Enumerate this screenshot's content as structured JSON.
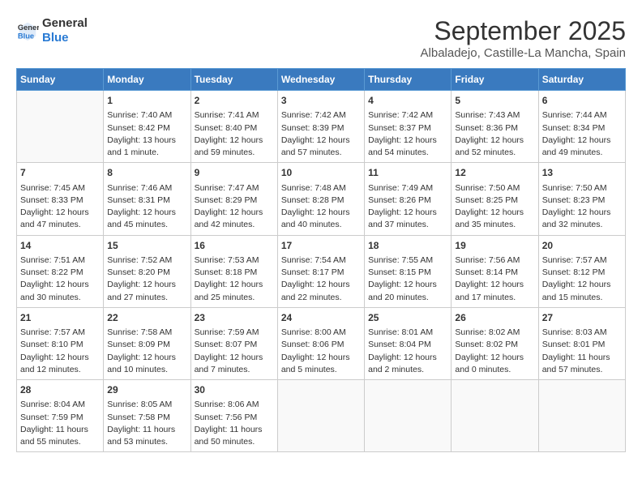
{
  "header": {
    "logo_general": "General",
    "logo_blue": "Blue",
    "title": "September 2025",
    "subtitle": "Albaladejo, Castille-La Mancha, Spain"
  },
  "days_header": [
    "Sunday",
    "Monday",
    "Tuesday",
    "Wednesday",
    "Thursday",
    "Friday",
    "Saturday"
  ],
  "weeks": [
    [
      {
        "day": "",
        "info": ""
      },
      {
        "day": "1",
        "info": "Sunrise: 7:40 AM\nSunset: 8:42 PM\nDaylight: 13 hours\nand 1 minute."
      },
      {
        "day": "2",
        "info": "Sunrise: 7:41 AM\nSunset: 8:40 PM\nDaylight: 12 hours\nand 59 minutes."
      },
      {
        "day": "3",
        "info": "Sunrise: 7:42 AM\nSunset: 8:39 PM\nDaylight: 12 hours\nand 57 minutes."
      },
      {
        "day": "4",
        "info": "Sunrise: 7:42 AM\nSunset: 8:37 PM\nDaylight: 12 hours\nand 54 minutes."
      },
      {
        "day": "5",
        "info": "Sunrise: 7:43 AM\nSunset: 8:36 PM\nDaylight: 12 hours\nand 52 minutes."
      },
      {
        "day": "6",
        "info": "Sunrise: 7:44 AM\nSunset: 8:34 PM\nDaylight: 12 hours\nand 49 minutes."
      }
    ],
    [
      {
        "day": "7",
        "info": "Sunrise: 7:45 AM\nSunset: 8:33 PM\nDaylight: 12 hours\nand 47 minutes."
      },
      {
        "day": "8",
        "info": "Sunrise: 7:46 AM\nSunset: 8:31 PM\nDaylight: 12 hours\nand 45 minutes."
      },
      {
        "day": "9",
        "info": "Sunrise: 7:47 AM\nSunset: 8:29 PM\nDaylight: 12 hours\nand 42 minutes."
      },
      {
        "day": "10",
        "info": "Sunrise: 7:48 AM\nSunset: 8:28 PM\nDaylight: 12 hours\nand 40 minutes."
      },
      {
        "day": "11",
        "info": "Sunrise: 7:49 AM\nSunset: 8:26 PM\nDaylight: 12 hours\nand 37 minutes."
      },
      {
        "day": "12",
        "info": "Sunrise: 7:50 AM\nSunset: 8:25 PM\nDaylight: 12 hours\nand 35 minutes."
      },
      {
        "day": "13",
        "info": "Sunrise: 7:50 AM\nSunset: 8:23 PM\nDaylight: 12 hours\nand 32 minutes."
      }
    ],
    [
      {
        "day": "14",
        "info": "Sunrise: 7:51 AM\nSunset: 8:22 PM\nDaylight: 12 hours\nand 30 minutes."
      },
      {
        "day": "15",
        "info": "Sunrise: 7:52 AM\nSunset: 8:20 PM\nDaylight: 12 hours\nand 27 minutes."
      },
      {
        "day": "16",
        "info": "Sunrise: 7:53 AM\nSunset: 8:18 PM\nDaylight: 12 hours\nand 25 minutes."
      },
      {
        "day": "17",
        "info": "Sunrise: 7:54 AM\nSunset: 8:17 PM\nDaylight: 12 hours\nand 22 minutes."
      },
      {
        "day": "18",
        "info": "Sunrise: 7:55 AM\nSunset: 8:15 PM\nDaylight: 12 hours\nand 20 minutes."
      },
      {
        "day": "19",
        "info": "Sunrise: 7:56 AM\nSunset: 8:14 PM\nDaylight: 12 hours\nand 17 minutes."
      },
      {
        "day": "20",
        "info": "Sunrise: 7:57 AM\nSunset: 8:12 PM\nDaylight: 12 hours\nand 15 minutes."
      }
    ],
    [
      {
        "day": "21",
        "info": "Sunrise: 7:57 AM\nSunset: 8:10 PM\nDaylight: 12 hours\nand 12 minutes."
      },
      {
        "day": "22",
        "info": "Sunrise: 7:58 AM\nSunset: 8:09 PM\nDaylight: 12 hours\nand 10 minutes."
      },
      {
        "day": "23",
        "info": "Sunrise: 7:59 AM\nSunset: 8:07 PM\nDaylight: 12 hours\nand 7 minutes."
      },
      {
        "day": "24",
        "info": "Sunrise: 8:00 AM\nSunset: 8:06 PM\nDaylight: 12 hours\nand 5 minutes."
      },
      {
        "day": "25",
        "info": "Sunrise: 8:01 AM\nSunset: 8:04 PM\nDaylight: 12 hours\nand 2 minutes."
      },
      {
        "day": "26",
        "info": "Sunrise: 8:02 AM\nSunset: 8:02 PM\nDaylight: 12 hours\nand 0 minutes."
      },
      {
        "day": "27",
        "info": "Sunrise: 8:03 AM\nSunset: 8:01 PM\nDaylight: 11 hours\nand 57 minutes."
      }
    ],
    [
      {
        "day": "28",
        "info": "Sunrise: 8:04 AM\nSunset: 7:59 PM\nDaylight: 11 hours\nand 55 minutes."
      },
      {
        "day": "29",
        "info": "Sunrise: 8:05 AM\nSunset: 7:58 PM\nDaylight: 11 hours\nand 53 minutes."
      },
      {
        "day": "30",
        "info": "Sunrise: 8:06 AM\nSunset: 7:56 PM\nDaylight: 11 hours\nand 50 minutes."
      },
      {
        "day": "",
        "info": ""
      },
      {
        "day": "",
        "info": ""
      },
      {
        "day": "",
        "info": ""
      },
      {
        "day": "",
        "info": ""
      }
    ]
  ]
}
